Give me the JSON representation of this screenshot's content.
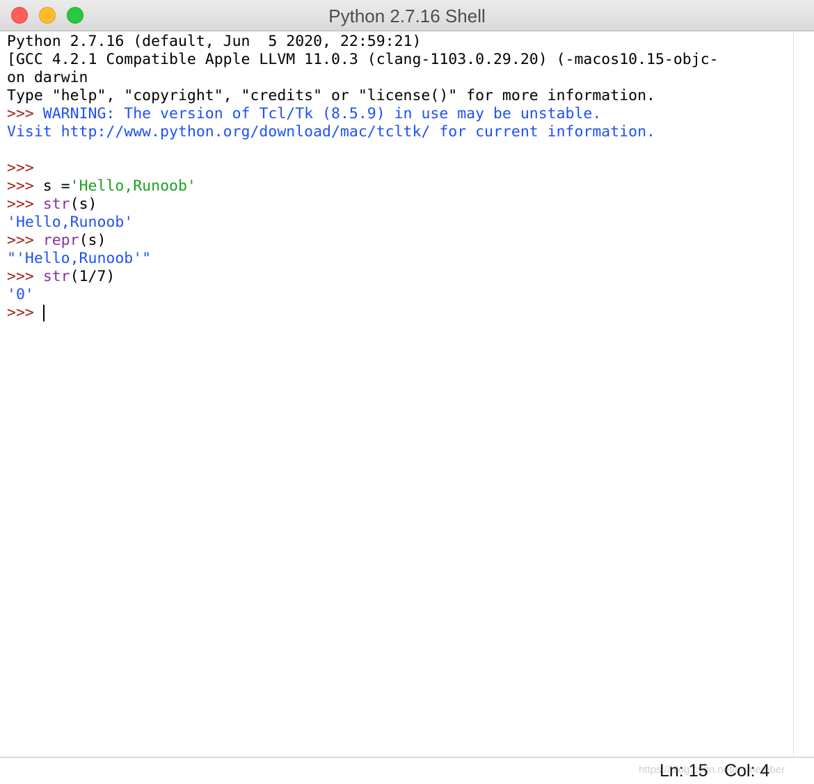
{
  "window": {
    "title": "Python 2.7.16 Shell"
  },
  "shell": {
    "banner": [
      "Python 2.7.16 (default, Jun  5 2020, 22:59:21)",
      "[GCC 4.2.1 Compatible Apple LLVM 11.0.3 (clang-1103.0.29.20) (-macos10.15-objc-",
      "on darwin",
      "Type \"help\", \"copyright\", \"credits\" or \"license()\" for more information."
    ],
    "prompt": ">>>",
    "warning": " WARNING: The version of Tcl/Tk (8.5.9) in use may be unstable.",
    "visit": "Visit http://www.python.org/download/mac/tcltk/ for current information.",
    "code1_var": " s =",
    "code1_str": "'Hello,Runoob'",
    "code2_fn": " str",
    "code2_args": "(s)",
    "out2": "'Hello,Runoob'",
    "code3_fn": " repr",
    "code3_args": "(s)",
    "out3": "\"'Hello,Runoob'\"",
    "code4_fn": " str",
    "code4_args": "(1/7)",
    "out4": "'0'"
  },
  "status": {
    "ln": "Ln: 15",
    "col": "Col: 4"
  },
  "watermark": "https://blog.csdn.net/u_member",
  "colors": {
    "prompt": "#a3221c",
    "output": "#1e51f5",
    "string": "#1aa11f",
    "builtin": "#8c2ea6"
  }
}
